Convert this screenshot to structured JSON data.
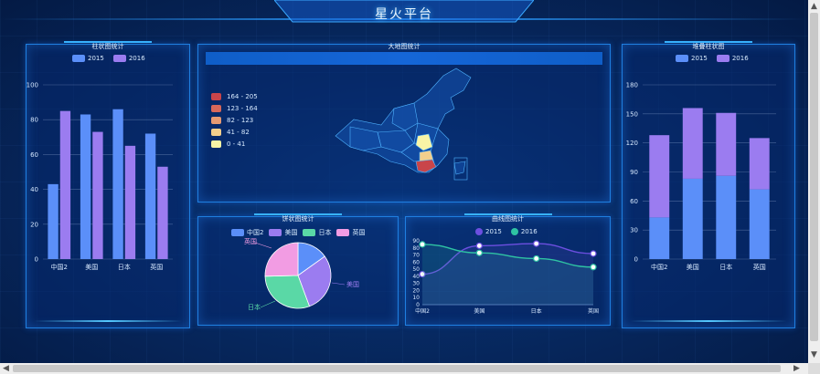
{
  "header": {
    "title": "星火平台"
  },
  "left_panel": {
    "title": "柱状图统计",
    "legend": [
      {
        "name": "2015",
        "color": "#5b8ff9"
      },
      {
        "name": "2016",
        "color": "#9b7cf0"
      }
    ],
    "chart_data": {
      "type": "bar",
      "categories": [
        "中国2",
        "美国",
        "日本",
        "英国"
      ],
      "series": [
        {
          "name": "2015",
          "values": [
            43,
            83,
            86,
            72
          ]
        },
        {
          "name": "2016",
          "values": [
            85,
            73,
            65,
            53
          ]
        }
      ],
      "ylim": [
        0,
        100
      ],
      "yticks": [
        0,
        20,
        40,
        60,
        80,
        100
      ]
    }
  },
  "map_panel": {
    "title": "大地图统计",
    "visual_map": [
      "164 - 205",
      "123 - 164",
      "82 - 123",
      "41 - 82",
      "0 - 41"
    ],
    "visual_colors": [
      "#c9454a",
      "#d8685a",
      "#e69a72",
      "#f3cf8c",
      "#f8f4a6"
    ]
  },
  "pie_panel": {
    "title": "饼状图统计",
    "legend": [
      {
        "name": "中国2",
        "color": "#5b8ff9"
      },
      {
        "name": "美国",
        "color": "#9b7cf0"
      },
      {
        "name": "日本",
        "color": "#5ad8a6"
      },
      {
        "name": "英国",
        "color": "#f29ce3"
      }
    ],
    "chart_data": {
      "type": "pie",
      "labels": [
        "中国2",
        "美国",
        "日本",
        "英国"
      ],
      "values": [
        43,
        83,
        86,
        72
      ]
    },
    "slice_labels": {
      "a": "英国",
      "b": "美国",
      "c": "日本"
    }
  },
  "line_panel": {
    "title": "曲线图统计",
    "legend": [
      {
        "name": "2015",
        "color": "#6c4fe0"
      },
      {
        "name": "2016",
        "color": "#2fc3a3"
      }
    ],
    "chart_data": {
      "type": "line",
      "categories": [
        "中国2",
        "美国",
        "日本",
        "英国"
      ],
      "series": [
        {
          "name": "2015",
          "values": [
            43,
            83,
            86,
            72
          ]
        },
        {
          "name": "2016",
          "values": [
            85,
            73,
            65,
            53
          ]
        }
      ],
      "ylim": [
        0,
        90
      ],
      "yticks": [
        0,
        10,
        20,
        30,
        40,
        50,
        60,
        70,
        80,
        90
      ]
    }
  },
  "right_panel": {
    "title": "堆叠柱状图",
    "legend": [
      {
        "name": "2015",
        "color": "#5b8ff9"
      },
      {
        "name": "2016",
        "color": "#9b7cf0"
      }
    ],
    "chart_data": {
      "type": "bar",
      "stacked": true,
      "categories": [
        "中国2",
        "美国",
        "日本",
        "英国"
      ],
      "series": [
        {
          "name": "2015",
          "values": [
            43,
            83,
            86,
            72
          ]
        },
        {
          "name": "2016",
          "values": [
            85,
            73,
            65,
            53
          ]
        }
      ],
      "ylim": [
        0,
        180
      ],
      "yticks": [
        0,
        30,
        60,
        90,
        120,
        150,
        180
      ]
    }
  }
}
